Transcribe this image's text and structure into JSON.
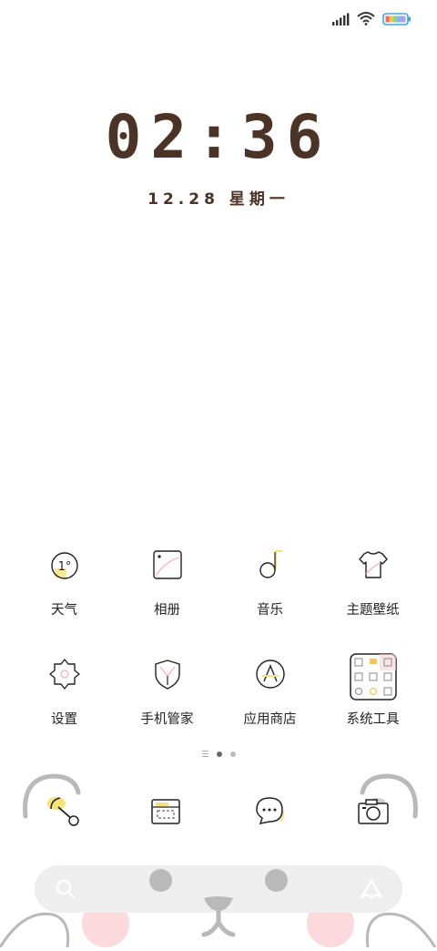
{
  "status": {
    "signal": "signal-icon",
    "wifi": "wifi-icon",
    "battery": "battery-icon"
  },
  "clock": {
    "time": "02:36",
    "date": "12.28 星期一"
  },
  "apps": [
    {
      "label": "天气",
      "icon": "weather-icon",
      "value": "1°"
    },
    {
      "label": "相册",
      "icon": "gallery-icon"
    },
    {
      "label": "音乐",
      "icon": "music-icon"
    },
    {
      "label": "主题壁纸",
      "icon": "theme-icon"
    },
    {
      "label": "设置",
      "icon": "settings-icon"
    },
    {
      "label": "手机管家",
      "icon": "security-icon"
    },
    {
      "label": "应用商店",
      "icon": "app-store-icon"
    },
    {
      "label": "系统工具",
      "icon": "tools-folder-icon"
    }
  ],
  "page_indicator": {
    "pages": 3,
    "current": 2
  },
  "dock": [
    {
      "icon": "phone-icon"
    },
    {
      "icon": "browser-icon"
    },
    {
      "icon": "messages-icon"
    },
    {
      "icon": "camera-icon"
    }
  ],
  "search": {
    "left_icon": "search-icon",
    "right_icon": "assistant-icon"
  },
  "colors": {
    "accent": "#4b3426",
    "yellow": "#f7e27a",
    "pink": "#f4b6c2",
    "search_bg": "#eeeeee"
  }
}
